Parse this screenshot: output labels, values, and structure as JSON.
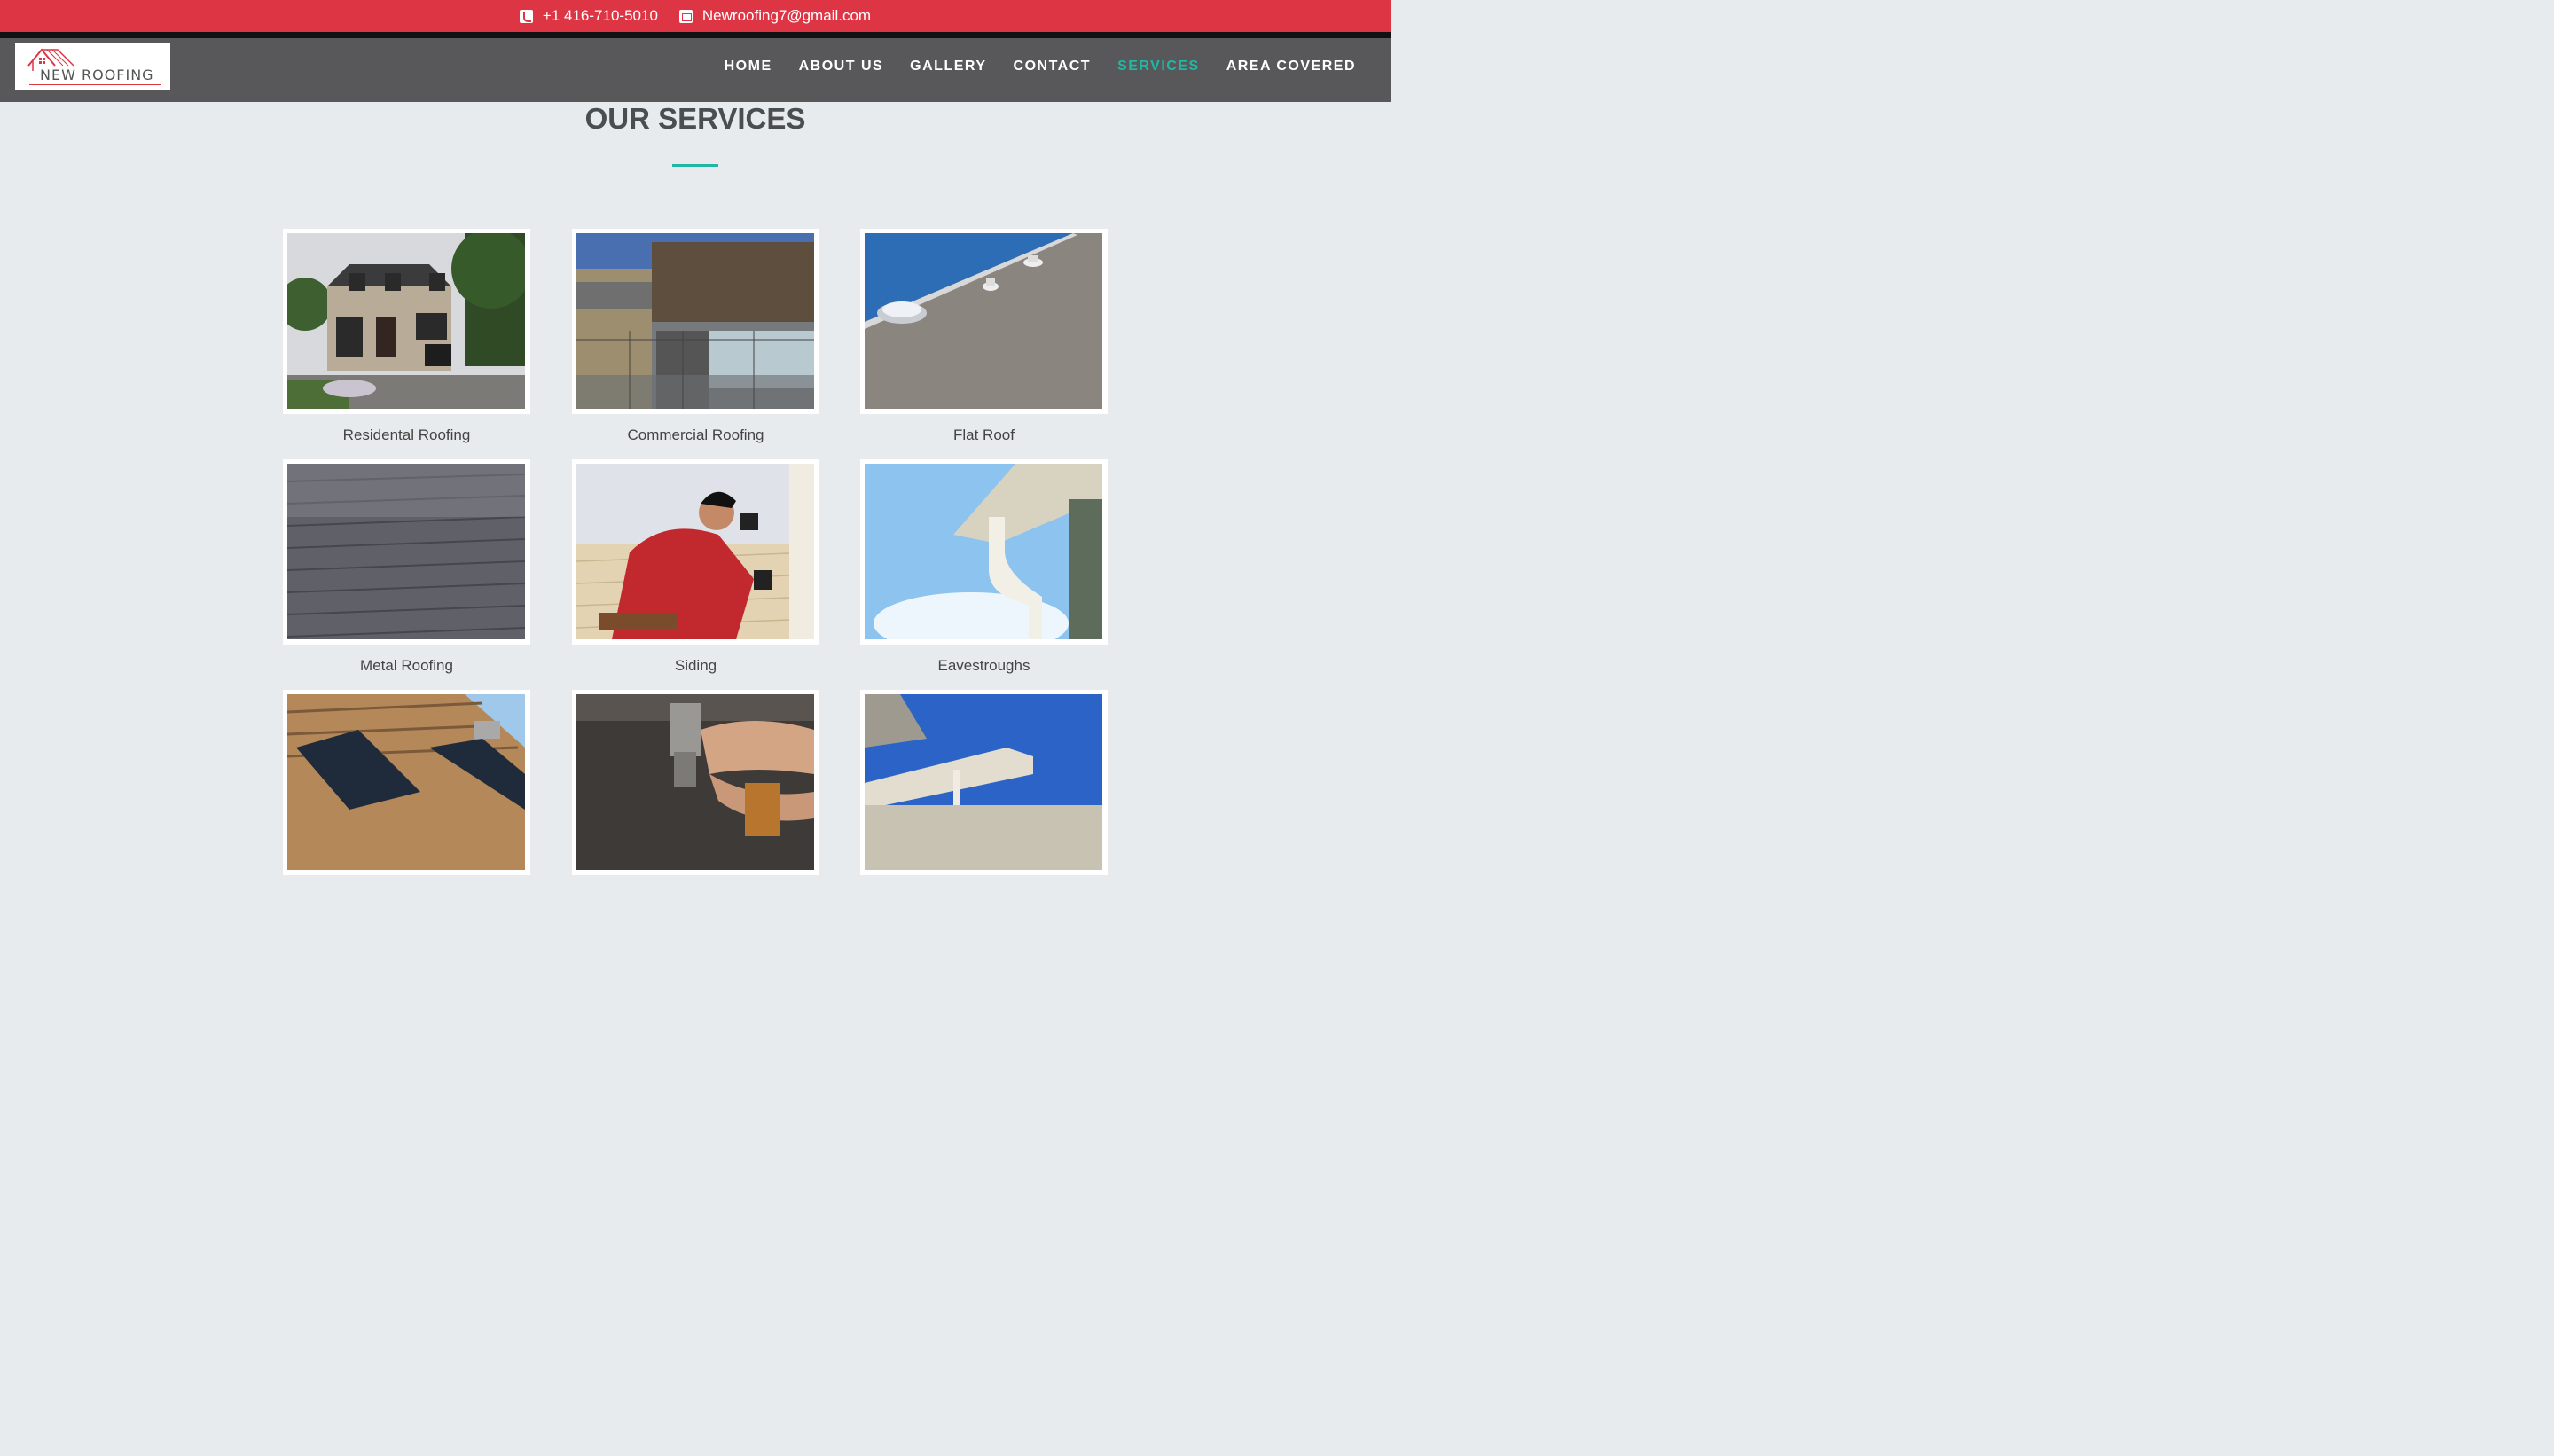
{
  "topbar": {
    "phone": "+1 416-710-5010",
    "email": "Newroofing7@gmail.com",
    "phone_icon": "phone-icon",
    "email_icon": "envelope-icon",
    "color": "#de3545"
  },
  "logo": {
    "text": "NEW ROOFING",
    "icon": "house-roof-icon"
  },
  "nav": {
    "items": [
      {
        "label": "HOME"
      },
      {
        "label": "ABOUT US"
      },
      {
        "label": "GALLERY"
      },
      {
        "label": "CONTACT"
      },
      {
        "label": "SERVICES",
        "active": true
      },
      {
        "label": "AREA COVERED"
      }
    ],
    "active_color": "#22b7a4"
  },
  "section": {
    "title": "OUR SERVICES"
  },
  "services": [
    {
      "label": "Residental Roofing"
    },
    {
      "label": "Commercial Roofing"
    },
    {
      "label": "Flat Roof"
    },
    {
      "label": "Metal Roofing"
    },
    {
      "label": "Siding"
    },
    {
      "label": "Eavestroughs"
    },
    {
      "label": ""
    },
    {
      "label": ""
    },
    {
      "label": ""
    }
  ]
}
